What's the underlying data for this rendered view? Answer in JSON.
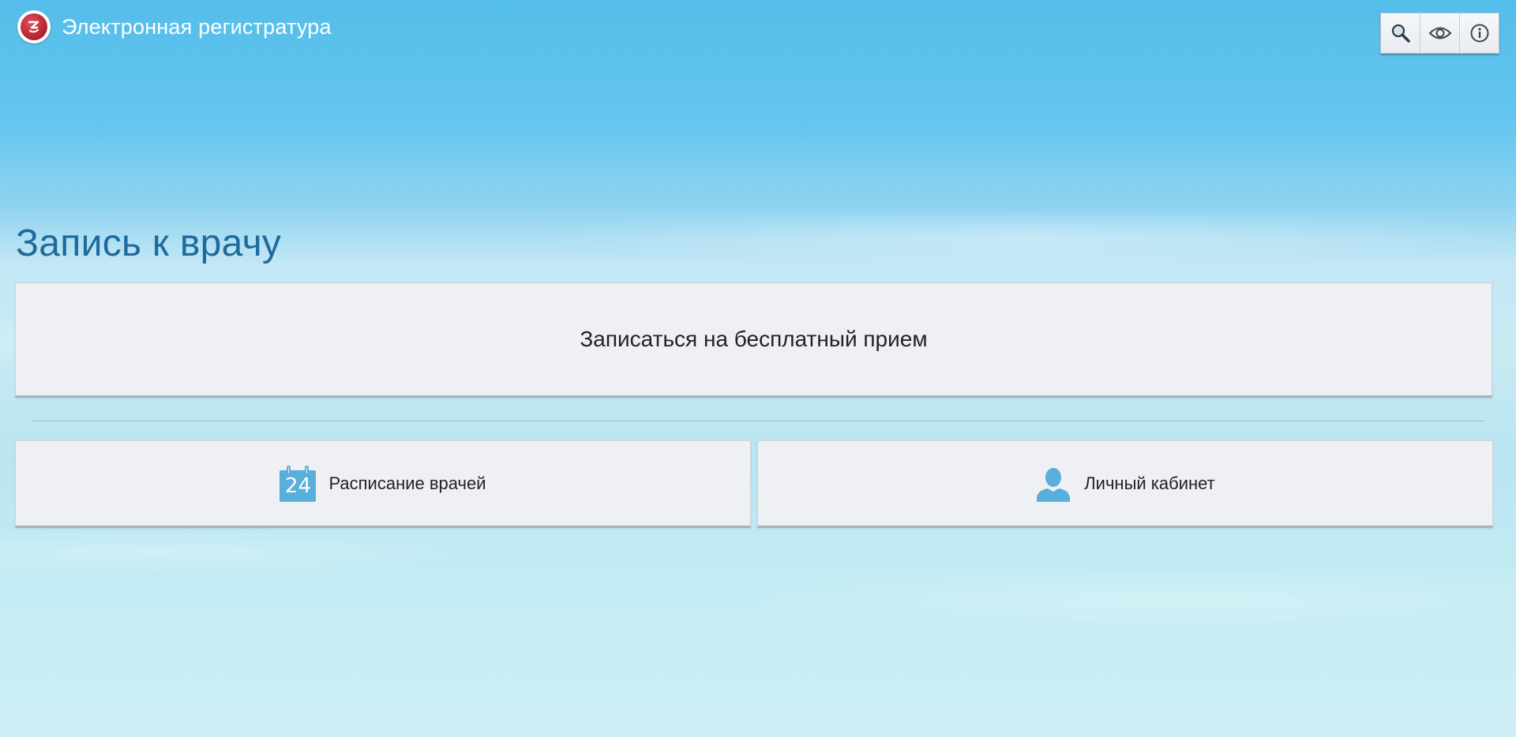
{
  "header": {
    "app_title": "Электронная регистратура",
    "logo_icon": "registry-logo-icon"
  },
  "toolbar": {
    "buttons": [
      {
        "name": "search-icon"
      },
      {
        "name": "eye-icon"
      },
      {
        "name": "info-icon"
      }
    ]
  },
  "main": {
    "page_title": "Запись к врачу",
    "primary_button_label": "Записаться на бесплатный прием",
    "schedule_button": {
      "label": "Расписание врачей",
      "icon": "calendar-icon",
      "icon_text": "24"
    },
    "cabinet_button": {
      "label": "Личный кабинет",
      "icon": "user-icon"
    }
  },
  "colors": {
    "accent": "#1e6a9a",
    "icon_blue": "#5aaedc",
    "logo_red": "#b3202d",
    "button_bg": "#eef0f4"
  }
}
